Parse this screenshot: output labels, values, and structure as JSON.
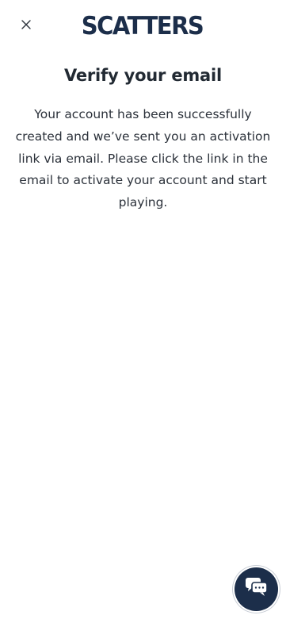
{
  "header": {
    "close_icon": "close-icon",
    "logo_text": "SCATTERS",
    "brand_color": "#1c2e4a"
  },
  "main": {
    "title": "Verify your email",
    "message": "Your account has been successfully created and we’ve sent you an activation link via email. Please click the link in the email to activate your account and start playing."
  },
  "chat": {
    "icon": "chat-bubbles-icon",
    "color": "#1c2e4a"
  }
}
